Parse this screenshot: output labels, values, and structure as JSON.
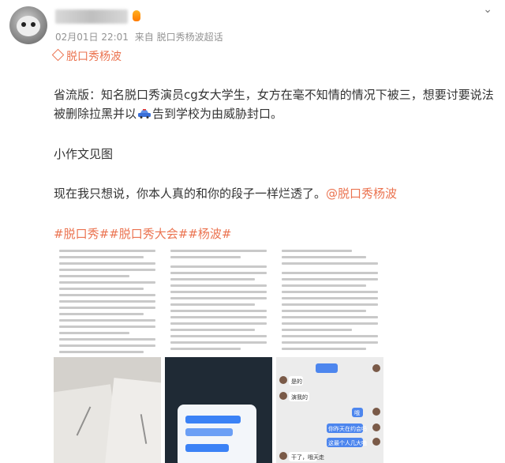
{
  "post": {
    "time": "02月01日 22:01",
    "source": "来自 脱口秀杨波超话",
    "topic": "脱口秀杨波",
    "p1_before_icon": "省流版：知名脱口秀演员cg女大学生，女方在毫不知情的情况下被三，想要讨要说法被删除拉黑并以",
    "p1_after_icon": "告到学校为由威胁封口。",
    "p2": "小作文见图",
    "p3_text": "现在我只想说，你本人真的和你的段子一样烂透了。",
    "p3_mention": "@脱口秀杨波",
    "tags": "#脱口秀##脱口秀大会##杨波#",
    "more_icon": "chevron-down-icon"
  },
  "chat": {
    "m1": "是的",
    "m2": "演我的",
    "m3": "哦",
    "m4": "你昨天在约会吗",
    "m5": "这最个人几大嗑",
    "m6": "干了，哦天走"
  },
  "colors": {
    "accent": "#eb7350",
    "meta": "#939393",
    "text": "#333333"
  }
}
